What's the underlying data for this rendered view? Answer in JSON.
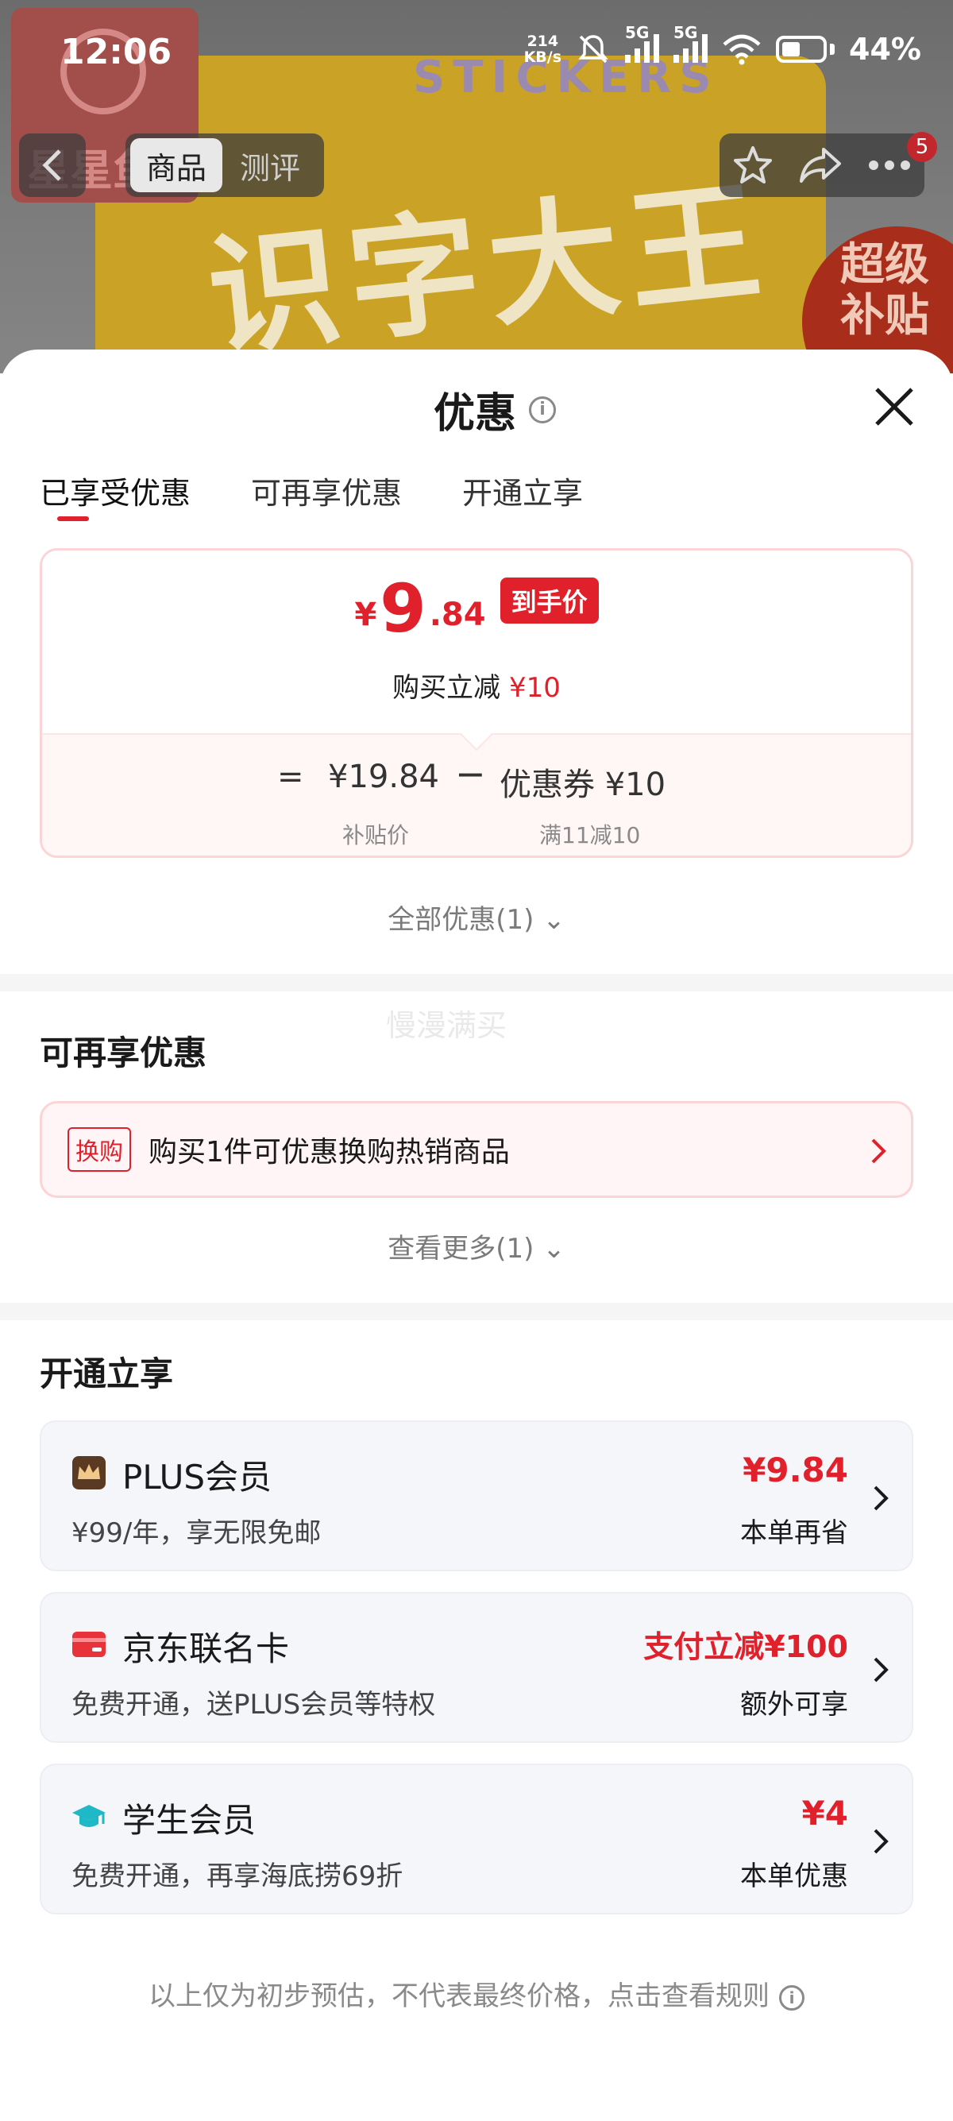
{
  "status_bar": {
    "time": "12:06",
    "net_speed_top": "214",
    "net_speed_unit": "KB/s",
    "sim1": "5G",
    "sim2": "5G",
    "battery": "44%"
  },
  "product_bg": {
    "brand_name": "星星鱼",
    "box_title": "识字大王",
    "box_subtitle": "STICKERS",
    "promo_badge": "超级补贴"
  },
  "nav": {
    "tab_product": "商品",
    "tab_review": "测评",
    "notification_count": "5"
  },
  "sheet": {
    "title": "优惠",
    "tabs": [
      "已享受优惠",
      "可再享优惠",
      "开通立享"
    ],
    "active_tab_index": 0
  },
  "deal": {
    "currency": "¥",
    "price_int": "9",
    "price_dec": ".84",
    "price_badge": "到手价",
    "save_prefix": "购买立减 ",
    "save_amount": "¥10",
    "eq": "=",
    "base_price": "¥19.84",
    "minus": "−",
    "coupon_text": "优惠券 ¥10",
    "base_label": "补贴价",
    "coupon_label": "满11减10"
  },
  "all_deals": "全部优惠(1) ⌄",
  "more_deals": {
    "title": "可再享优惠",
    "watermark": "慢漫满买",
    "swap_tag": "换购",
    "swap_text": "购买1件可优惠换购热销商品",
    "see_more": "查看更多(1) ⌄"
  },
  "open_now": {
    "title": "开通立享",
    "cards": [
      {
        "icon": "crown-icon",
        "name": "PLUS会员",
        "desc": "¥99/年，享无限免邮",
        "value": "¥9.84",
        "sub": "本单再省"
      },
      {
        "icon": "card-icon",
        "name": "京东联名卡",
        "desc": "免费开通，送PLUS会员等特权",
        "value": "支付立减¥100",
        "sub": "额外可享"
      },
      {
        "icon": "graduation-cap-icon",
        "name": "学生会员",
        "desc": "免费开通，再享海底捞69折",
        "value": "¥4",
        "sub": "本单优惠"
      }
    ]
  },
  "footnote": "以上仅为初步预估，不代表最终价格，点击查看规则",
  "colors": {
    "accent": "#e0202b",
    "pink_border": "#fbd4d6",
    "card_bg": "#f5f6fa"
  }
}
